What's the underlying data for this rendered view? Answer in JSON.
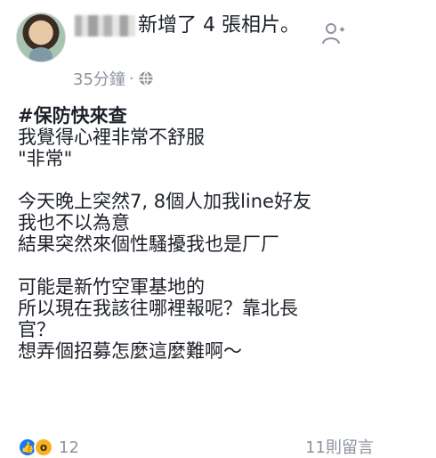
{
  "header": {
    "post_action_text": "新增了 4 張相片。",
    "time": "35分鐘",
    "separator": "·"
  },
  "post": {
    "lines": [
      "#保防快來查",
      "我覺得心裡非常不舒服",
      "\"非常\"",
      "",
      "今天晚上突然7, 8個人加我line好友",
      "我也不以為意",
      "結果突然來個性騷擾我也是厂厂",
      "",
      "可能是新竹空軍基地的",
      "所以現在我該往哪裡報呢？靠北長",
      "官？",
      "想弄個招募怎麼這麼難啊～"
    ]
  },
  "footer": {
    "reaction_count": "12",
    "comment_count": "11則留言"
  },
  "icons": {
    "add_friend": "add-friend-icon",
    "globe": "globe-icon",
    "like": "like-icon",
    "wow": "wow-icon"
  },
  "colors": {
    "text": "#1d2129",
    "meta": "#8d949e",
    "like": "#1877f2",
    "wow": "#f7b125"
  }
}
